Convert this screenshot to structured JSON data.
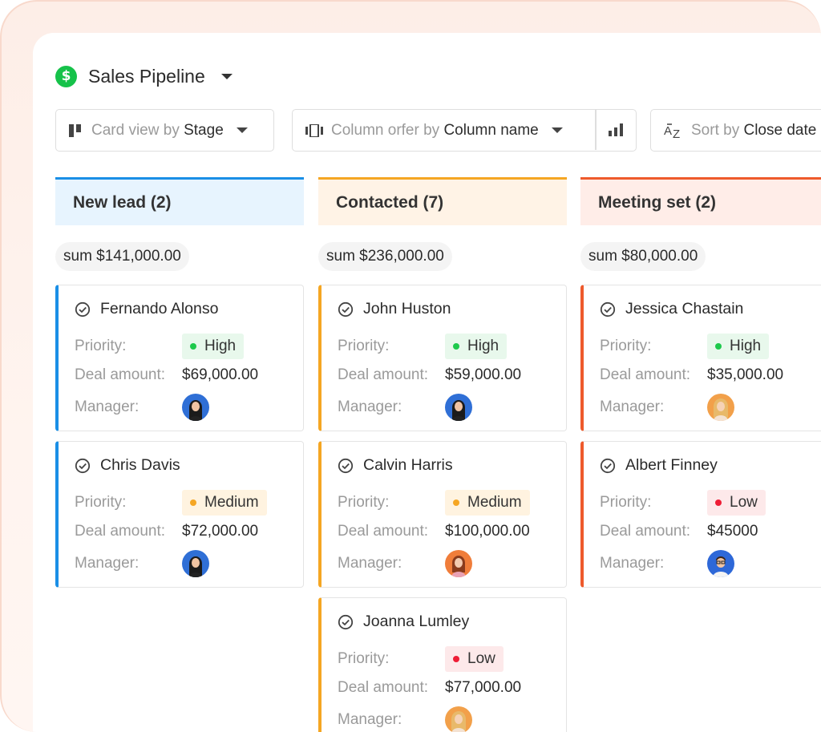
{
  "app": {
    "title": "Sales Pipeline",
    "logo_symbol": "$",
    "logo_color": "#16c24a"
  },
  "toolbar": {
    "card_view": {
      "prefix": "Card view by",
      "value": "Stage"
    },
    "column_order": {
      "prefix": "Column orfer by",
      "value": "Column name"
    },
    "sort": {
      "prefix": "Sort by",
      "value": "Close date"
    }
  },
  "labels": {
    "priority": "Priority:",
    "deal_amount": "Deal amount:",
    "manager": "Manager:"
  },
  "priority_colors": {
    "High": {
      "dot": "#1ec94c",
      "bg": "#e8f8ec"
    },
    "Medium": {
      "dot": "#f5a623",
      "bg": "#fff3e0"
    },
    "Low": {
      "dot": "#ee1d36",
      "bg": "#fde9ea"
    }
  },
  "columns": [
    {
      "title": "New lead (2)",
      "sum": "sum $141,000.00",
      "accent": "#1a8fe6",
      "header_bg": "#e7f4fe",
      "cards": [
        {
          "name": "Fernando Alonso",
          "priority": "High",
          "deal_amount": "$69,000.00",
          "manager_avatar": "avatar-woman-dark"
        },
        {
          "name": "Chris Davis",
          "priority": "Medium",
          "deal_amount": "$72,000.00",
          "manager_avatar": "avatar-woman-dark"
        }
      ]
    },
    {
      "title": "Contacted (7)",
      "sum": "sum $236,000.00",
      "accent": "#f5a623",
      "header_bg": "#fff3e6",
      "cards": [
        {
          "name": "John Huston",
          "priority": "High",
          "deal_amount": "$59,000.00",
          "manager_avatar": "avatar-woman-dark"
        },
        {
          "name": "Calvin Harris",
          "priority": "Medium",
          "deal_amount": "$100,000.00",
          "manager_avatar": "avatar-woman-orange"
        },
        {
          "name": "Joanna Lumley",
          "priority": "Low",
          "deal_amount": "$77,000.00",
          "manager_avatar": "avatar-woman-blonde"
        }
      ]
    },
    {
      "title": "Meeting set (2)",
      "sum": "sum $80,000.00",
      "accent": "#ee5a2c",
      "header_bg": "#ffede8",
      "cards": [
        {
          "name": "Jessica Chastain",
          "priority": "High",
          "deal_amount": "$35,000.00",
          "manager_avatar": "avatar-woman-blonde"
        },
        {
          "name": "Albert Finney",
          "priority": "Low",
          "deal_amount": "$45000",
          "manager_avatar": "avatar-man-glasses"
        }
      ]
    }
  ]
}
